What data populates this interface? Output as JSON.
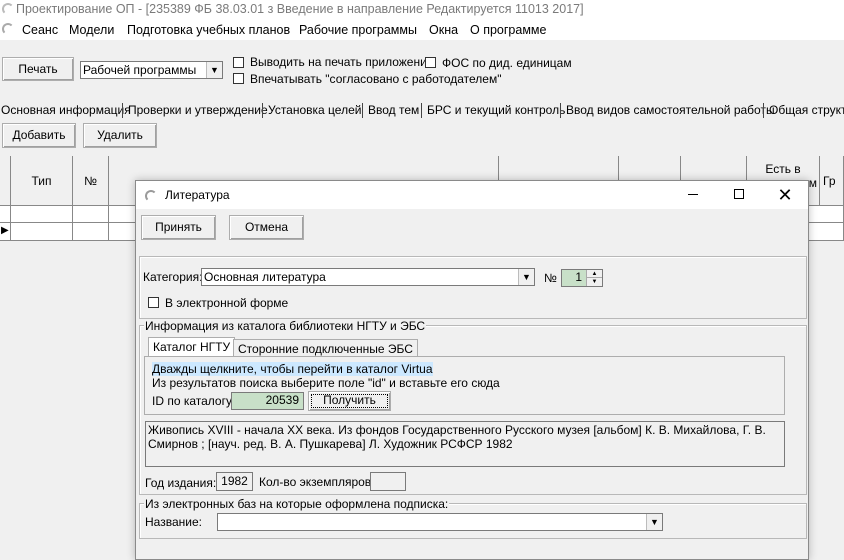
{
  "window": {
    "title": "Проектирование ОП - [235389 ФБ 38.03.01 з Введение в направление Редактируется 11013 2017]"
  },
  "menu": {
    "items": [
      "Сеанс",
      "Модели",
      "Подготовка учебных планов",
      "Рабочие программы",
      "Окна",
      "О программе"
    ]
  },
  "toolbar": {
    "print_label": "Печать",
    "print_type_value": "Рабочей программы",
    "chk_print_appendix": "Выводить на печать приложения",
    "chk_fos": "ФОС по дид. единицам",
    "chk_agreed": "Впечатывать \"согласовано с работодателем\""
  },
  "tabs": [
    "Основная информация",
    "Проверки и утверждение",
    "Установка целей",
    "Ввод тем",
    "БРС и текущий контроль",
    "Ввод видов самостоятельной работы",
    "Общая структ"
  ],
  "actions": {
    "add_label": "Добавить",
    "delete_label": "Удалить"
  },
  "grid": {
    "headers": {
      "type": "Тип",
      "num": "№",
      "in_ebs_1": "Есть в",
      "in_ebs_2": "м",
      "gr": "Гр"
    }
  },
  "dialog": {
    "title": "Литература",
    "accept_label": "Принять",
    "cancel_label": "Отмена",
    "category_label": "Категория:",
    "category_value": "Основная литература",
    "num_label": "№",
    "num_value": "1",
    "electronic_label": "В электронной форме",
    "catalog_group_title": "Информация из каталога библиотеки НГТУ и ЭБС",
    "subtabs": [
      "Каталог НГТУ",
      "Сторонние подключенные ЭБС"
    ],
    "hint_line1": "Дважды щелкните, чтобы перейти в каталог Virtua",
    "hint_line2": "Из результатов поиска выберите поле \"id\" и вставьте его сюда",
    "id_label": "ID по каталогу",
    "id_value": "20539",
    "get_label": "Получить",
    "description": "Живопись XVIII - начала XX века. Из фондов Государственного Русского музея [альбом] К. В. Михайлова, Г. В. Смирнов ; [науч. ред. В. А. Пушкарева] Л. Художник РСФСР 1982",
    "year_label": "Год издания:",
    "year_value": "1982",
    "copies_label": "Кол-во экземпляров",
    "copies_value": "",
    "ebs_group_title": "Из электронных баз на которые оформлена подписка:",
    "name_label": "Название:",
    "name_value": ""
  }
}
